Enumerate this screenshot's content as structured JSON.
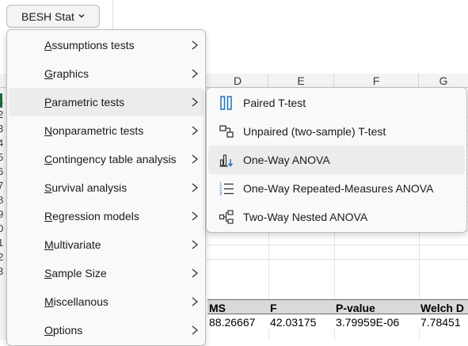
{
  "ribbon": {
    "button_label": "BESH Stat",
    "button_icon": "chevron-down-icon"
  },
  "sheet": {
    "columns": [
      "D",
      "E",
      "F",
      "G"
    ],
    "row_numbers": [
      "1",
      "2",
      "3",
      "4",
      "5",
      "6",
      "7",
      "8",
      "9",
      "0",
      "1",
      "2",
      "3"
    ],
    "selected_row_number": "1",
    "table_headers": [
      "MS",
      "F",
      "P-value",
      "Welch D"
    ],
    "table_row": [
      "88.26667",
      "42.03175",
      "3.79959E-06",
      "7.78451"
    ]
  },
  "menu": {
    "items": [
      {
        "before": "",
        "key": "A",
        "after": "ssumptions tests"
      },
      {
        "before": "",
        "key": "G",
        "after": "raphics"
      },
      {
        "before": "",
        "key": "P",
        "after": "arametric tests"
      },
      {
        "before": "",
        "key": "N",
        "after": "onparametric tests"
      },
      {
        "before": "",
        "key": "C",
        "after": "ontingency table analysis"
      },
      {
        "before": "",
        "key": "S",
        "after": "urvival analysis"
      },
      {
        "before": "",
        "key": "R",
        "after": "egression models"
      },
      {
        "before": "",
        "key": "M",
        "after": "ultivariate"
      },
      {
        "before": "",
        "key": "S",
        "after": "ample Size"
      },
      {
        "before": "",
        "key": "M",
        "after": "iscellanous"
      },
      {
        "before": "",
        "key": "O",
        "after": "ptions"
      }
    ],
    "highlighted_item": "Parametric tests"
  },
  "submenu": {
    "items": [
      {
        "label": "Paired T-test",
        "icon": "paired-bars-icon"
      },
      {
        "label": "Unpaired (two-sample) T-test",
        "icon": "unpaired-boxes-icon"
      },
      {
        "label": "One-Way ANOVA",
        "icon": "bar-chart-down-arrow-icon"
      },
      {
        "label": "One-Way Repeated-Measures ANOVA",
        "icon": "numbered-list-icon"
      },
      {
        "label": "Two-Way Nested ANOVA",
        "icon": "hierarchy-icon"
      }
    ],
    "highlighted_item": "One-Way ANOVA"
  },
  "colors": {
    "accent_blue": "#1f6fc4",
    "selection_green": "#1d6b3e",
    "menu_hover": "#ececec"
  }
}
